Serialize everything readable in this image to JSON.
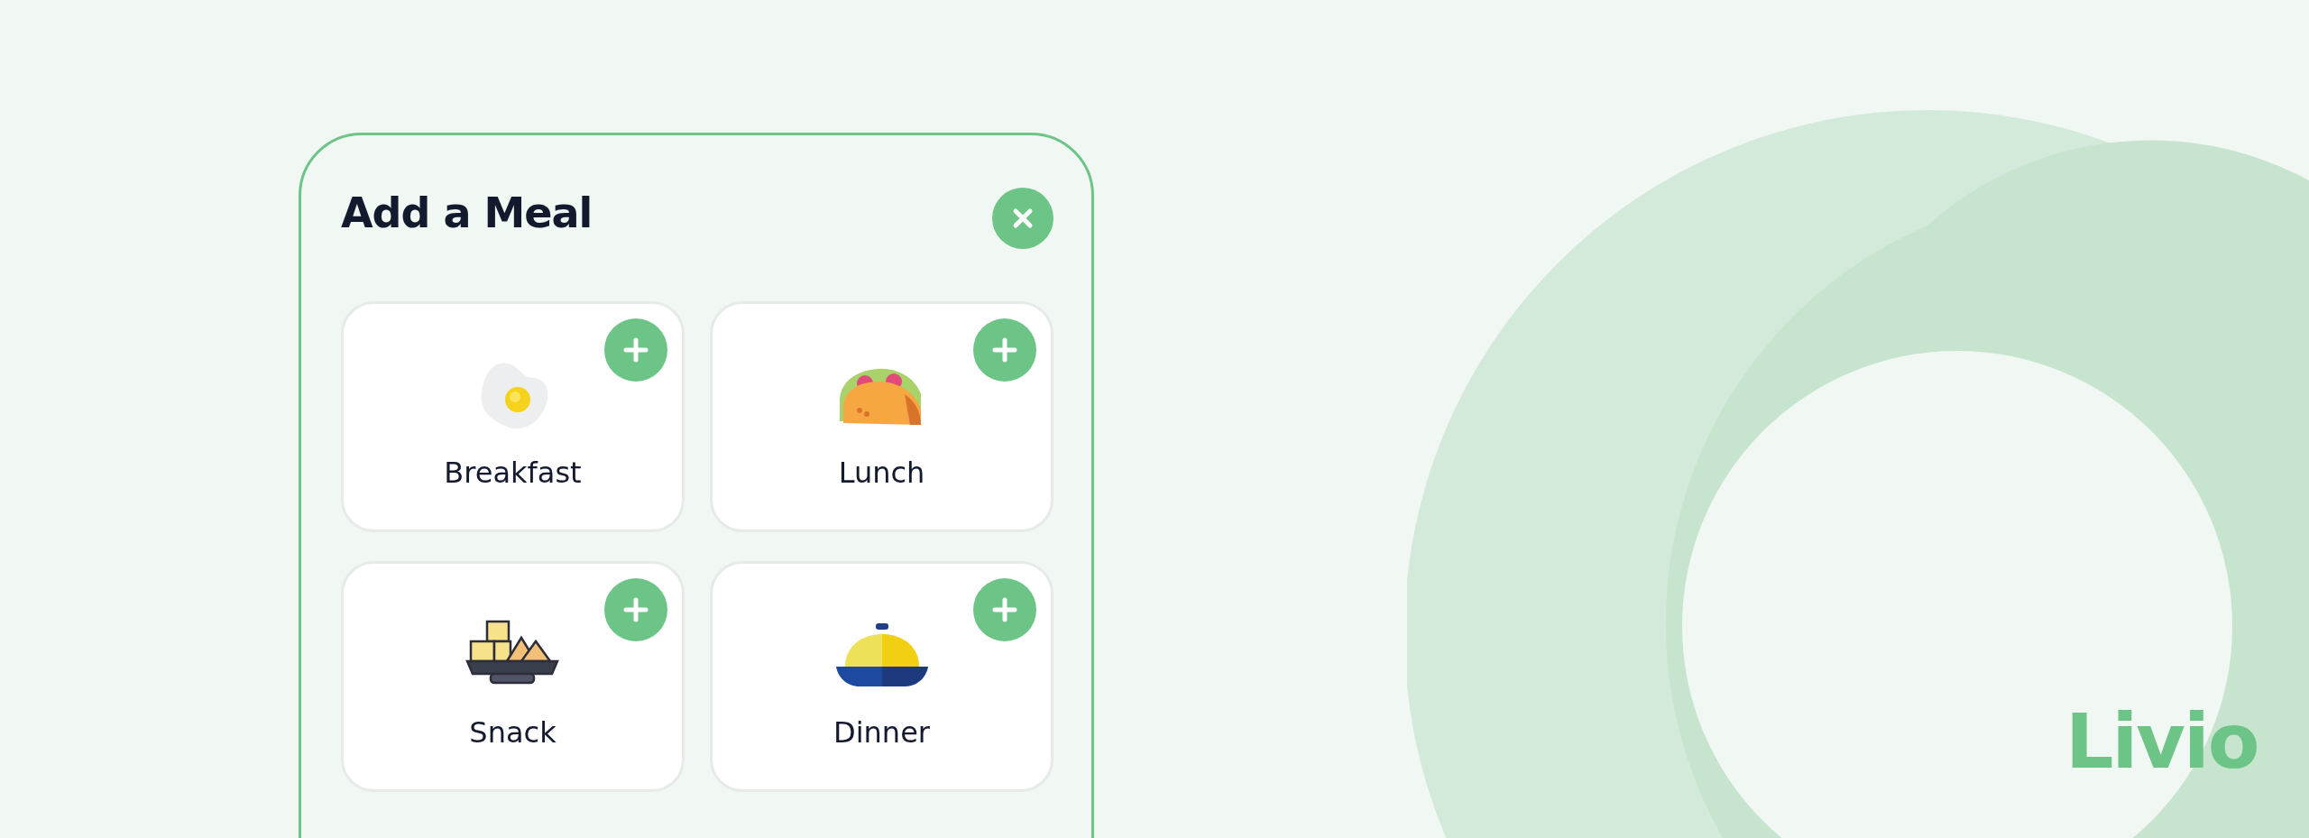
{
  "dialog": {
    "title": "Add a Meal",
    "meals": [
      {
        "label": "Breakfast",
        "kind": "egg"
      },
      {
        "label": "Lunch",
        "kind": "taco"
      },
      {
        "label": "Snack",
        "kind": "snack"
      },
      {
        "label": "Dinner",
        "kind": "cloche"
      }
    ]
  },
  "logo": {
    "text": "Livio"
  }
}
